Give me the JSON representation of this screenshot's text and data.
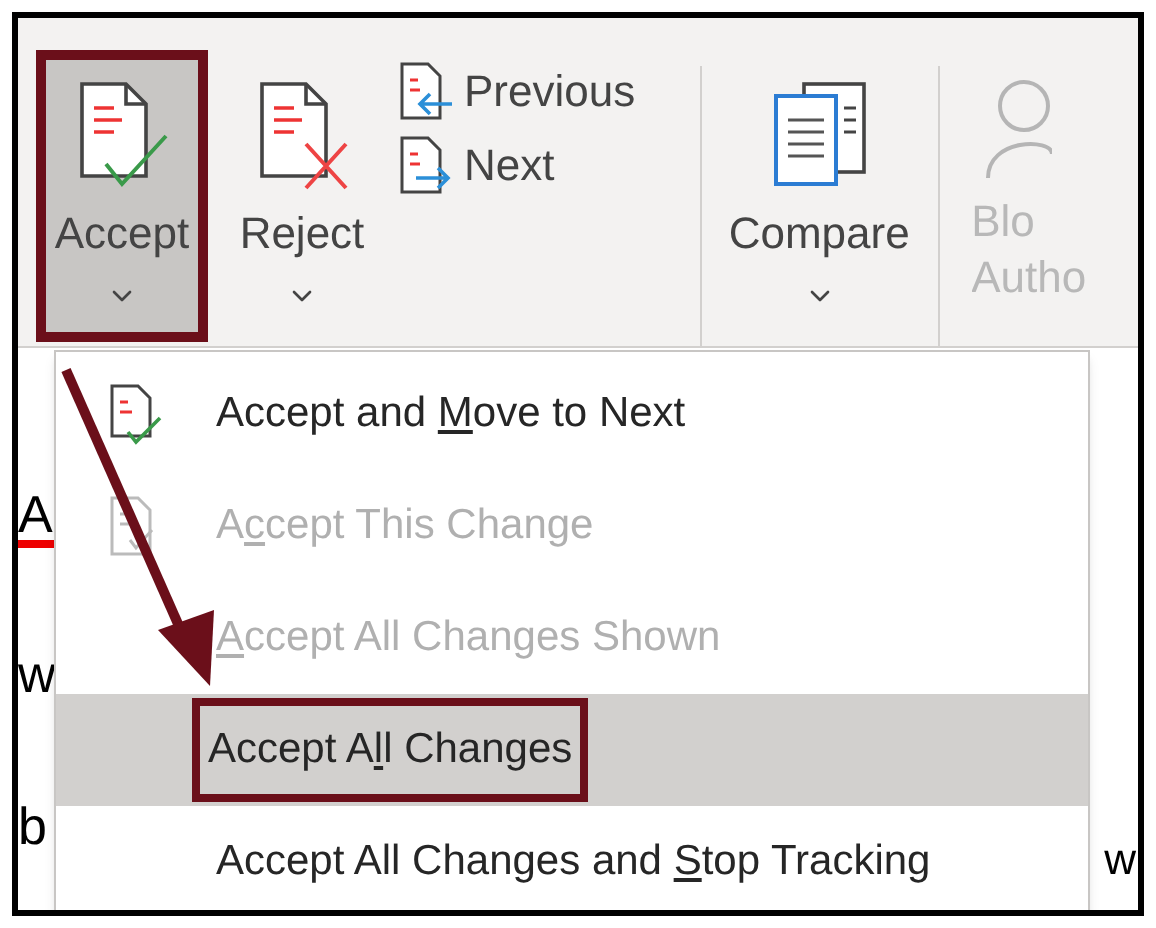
{
  "ribbon": {
    "buttons": [
      {
        "kind": "accept",
        "label": "Accept",
        "dropdown": true,
        "pressed": true,
        "highlighted": true
      },
      {
        "kind": "reject",
        "label": "Reject",
        "dropdown": true,
        "pressed": false,
        "highlighted": false
      },
      {
        "kind": "navigation",
        "items": [
          {
            "kind": "previous",
            "label": "Previous"
          },
          {
            "kind": "next",
            "label": "Next"
          }
        ]
      },
      {
        "kind": "separator"
      },
      {
        "kind": "compare",
        "label": "Compare",
        "dropdown": true,
        "pressed": false,
        "highlighted": false
      },
      {
        "kind": "separator"
      },
      {
        "kind": "blocked",
        "lines": [
          "Blo",
          "Autho"
        ]
      }
    ]
  },
  "document": {
    "left_fragments": [
      "A",
      "w",
      "b"
    ],
    "right_fragments": [
      "w"
    ]
  },
  "menu": {
    "items": [
      {
        "kind": "checked",
        "before": "Accept and ",
        "key": "M",
        "after": "ove to Next",
        "disabled": false,
        "selected": false,
        "highlighted": false
      },
      {
        "kind": "faded",
        "before": "A",
        "key": "c",
        "after": "cept This Change",
        "disabled": true,
        "selected": false,
        "highlighted": false
      },
      {
        "kind": "plain",
        "key": "A",
        "after": "ccept All Changes Shown",
        "disabled": true,
        "selected": false,
        "highlighted": false
      },
      {
        "kind": "plain",
        "before": "Accept A",
        "key": "l",
        "after": "l Changes",
        "disabled": false,
        "selected": true,
        "highlighted": true
      },
      {
        "kind": "plain",
        "before": "Accept All Changes and ",
        "key": "S",
        "after": "top Tracking",
        "disabled": false,
        "selected": false,
        "highlighted": false
      }
    ]
  },
  "annotation_arrow": true
}
